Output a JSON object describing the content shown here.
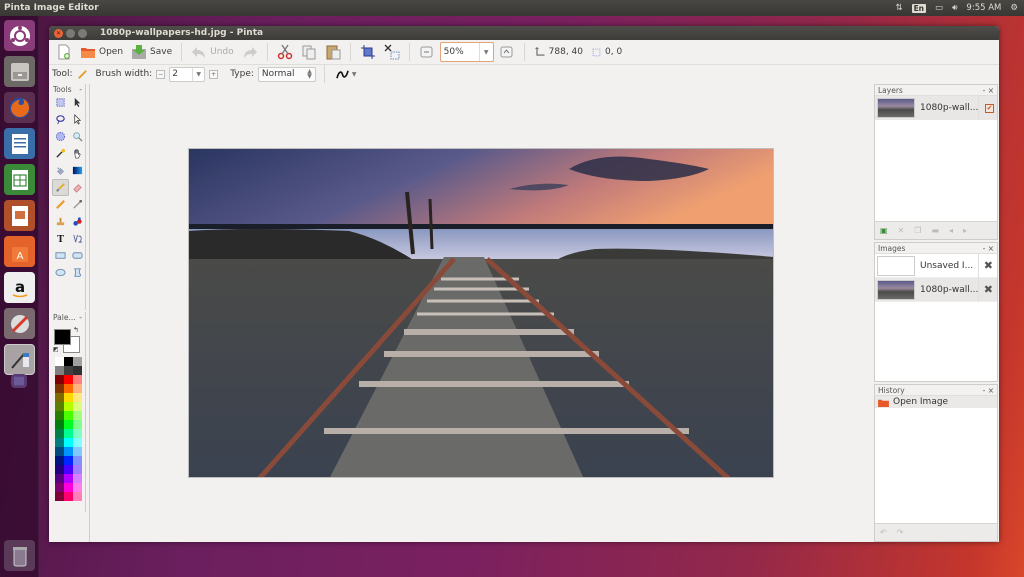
{
  "topbar": {
    "app_name": "Pinta Image Editor",
    "keyboard_layout": "En",
    "clock": "9:55 AM",
    "icons": [
      "network-icon",
      "keyboard-icon",
      "battery-icon",
      "volume-icon",
      "power-gear-icon"
    ]
  },
  "launcher": {
    "items": [
      "ubuntu-dash",
      "files",
      "firefox",
      "libreoffice-writer",
      "libreoffice-calc",
      "libreoffice-impress",
      "ubuntu-software",
      "amazon",
      "system-settings",
      "pinta",
      "workspace-switcher",
      "trash"
    ]
  },
  "window": {
    "title": "1080p-wallpapers-hd.jpg - Pinta"
  },
  "toolbar": {
    "new_label": "",
    "open_label": "Open",
    "save_label": "Save",
    "undo_label": "Undo",
    "zoom_value": "50%",
    "image_size": "788, 40",
    "selection_size": "0, 0"
  },
  "tool_options": {
    "tool_label": "Tool:",
    "brush_width_label": "Brush width:",
    "brush_width_value": "2",
    "type_label": "Type:",
    "type_value": "Normal"
  },
  "tools_panel": {
    "title": "Tools",
    "tools": [
      "rectangle-select",
      "move-selected",
      "lasso-select",
      "move-selection",
      "ellipse-select",
      "zoom",
      "magic-wand",
      "pan",
      "paint-bucket",
      "gradient",
      "paintbrush",
      "eraser",
      "pencil",
      "color-picker",
      "clone-stamp",
      "recolor",
      "text",
      "line-curve",
      "rectangle",
      "rounded-rectangle",
      "ellipse",
      "freeform-shape"
    ],
    "active_tool": "paintbrush"
  },
  "palette_panel": {
    "title": "Pale...",
    "primary_color": "#000000",
    "secondary_color": "#ffffff",
    "swatches": [
      "#ffffff",
      "#000000",
      "#a0a0a0",
      "#808080",
      "#404040",
      "#303030",
      "#7f0000",
      "#ff0000",
      "#ff7f7f",
      "#7f3300",
      "#ff6a00",
      "#ffb27f",
      "#7f6a00",
      "#ffd800",
      "#ffe97f",
      "#5b7f00",
      "#b6ff00",
      "#daff7f",
      "#267f00",
      "#4cff00",
      "#a5ff7f",
      "#007f0e",
      "#00ff21",
      "#7fff8e",
      "#007f46",
      "#00ff90",
      "#7fffc5",
      "#007f7f",
      "#00ffff",
      "#7fffff",
      "#004a7f",
      "#0094ff",
      "#7fc9ff",
      "#00137f",
      "#0026ff",
      "#7f92ff",
      "#21007f",
      "#4800ff",
      "#a17fff",
      "#57007f",
      "#b200ff",
      "#d67fff",
      "#7f006e",
      "#ff00dc",
      "#ff7fed",
      "#7f0037",
      "#ff006e",
      "#ff7fb6"
    ]
  },
  "layers_panel": {
    "title": "Layers",
    "layers": [
      {
        "name": "1080p-wall...",
        "visible": true
      }
    ]
  },
  "images_panel": {
    "title": "Images",
    "images": [
      {
        "name": "Unsaved I..."
      },
      {
        "name": "1080p-wall..."
      }
    ]
  },
  "history_panel": {
    "title": "History",
    "items": [
      {
        "label": "Open Image"
      }
    ]
  },
  "colors": {
    "accent": "#e9643a",
    "window_bg": "#f2f1f0"
  }
}
